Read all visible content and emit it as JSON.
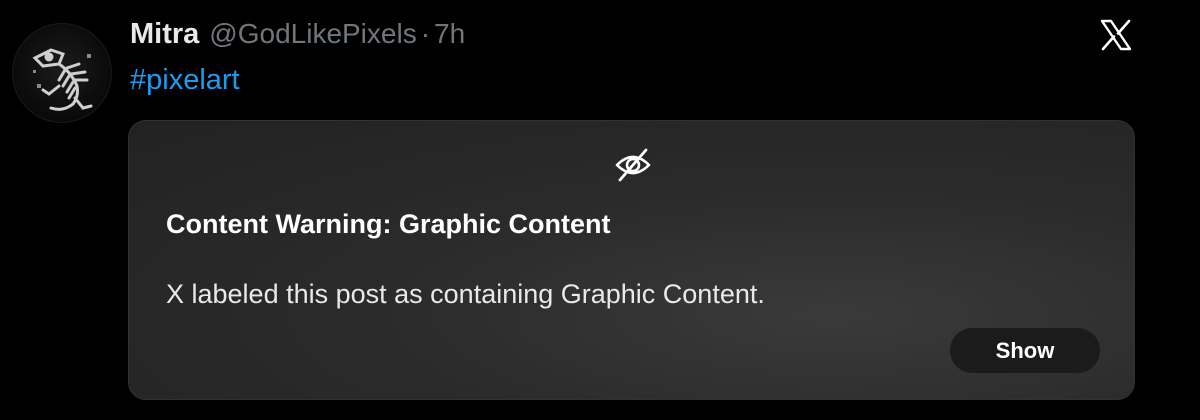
{
  "post": {
    "author_name": "Mitra",
    "author_handle": "@GodLikePixels",
    "separator": "·",
    "timestamp": "7h",
    "body_text": "#pixelart"
  },
  "content_warning": {
    "title": "Content Warning: Graphic Content",
    "message": "X labeled this post as containing Graphic Content.",
    "show_label": "Show"
  },
  "icons": {
    "avatar": "skeleton-avatar-icon",
    "logo": "x-logo-icon",
    "hidden": "eye-slash-icon"
  },
  "colors": {
    "background": "#000000",
    "primary_text": "#e7e9ea",
    "secondary_text": "#71767b",
    "link": "#1d9bf0",
    "card_background": "#2b2b2b",
    "button_background": "#1b1b1b"
  }
}
